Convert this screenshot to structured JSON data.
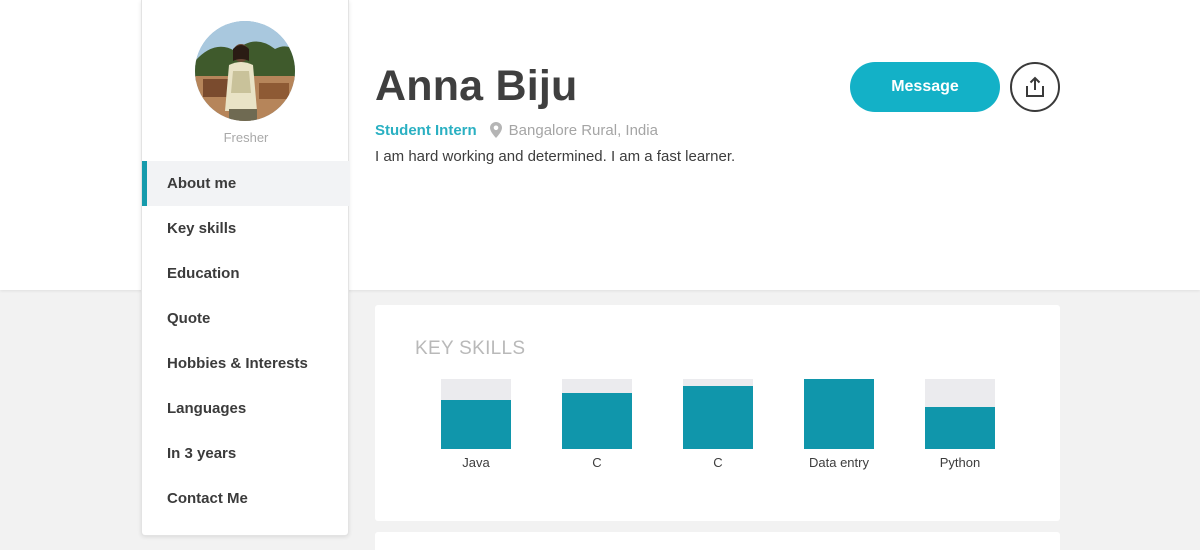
{
  "profile": {
    "name": "Anna Biju",
    "status": "Fresher",
    "role": "Student Intern",
    "location": "Bangalore Rural, India",
    "bio": "I am hard working and determined. I am a fast learner.",
    "avatar_icon": "profile-photo"
  },
  "nav": {
    "items": [
      {
        "label": "About me",
        "active": true
      },
      {
        "label": "Key skills",
        "active": false
      },
      {
        "label": "Education",
        "active": false
      },
      {
        "label": "Quote",
        "active": false
      },
      {
        "label": "Hobbies & Interests",
        "active": false
      },
      {
        "label": "Languages",
        "active": false
      },
      {
        "label": "In 3 years",
        "active": false
      },
      {
        "label": "Contact Me",
        "active": false
      }
    ]
  },
  "actions": {
    "message_label": "Message",
    "share_icon": "share-icon"
  },
  "key_skills": {
    "title": "KEY SKILLS",
    "skills": [
      {
        "label": "Java",
        "level": 0.7
      },
      {
        "label": "C",
        "level": 0.8
      },
      {
        "label": "C",
        "level": 0.9
      },
      {
        "label": "Data entry",
        "level": 1.0
      },
      {
        "label": "Python",
        "level": 0.6
      }
    ]
  },
  "colors": {
    "accent": "#13b1c7",
    "skill_fill": "#1096ab",
    "skill_track": "#ebebee",
    "role_text": "#2ab0c2"
  }
}
